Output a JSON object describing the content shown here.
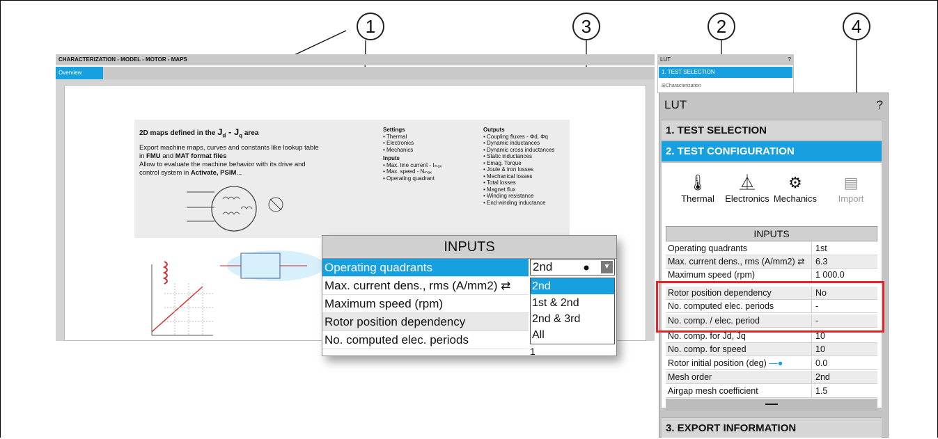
{
  "callouts": [
    "1",
    "3",
    "2",
    "4"
  ],
  "back_window": {
    "title": "CHARACTERIZATION - MODEL - MOTOR - MAPS",
    "tab": "Overview",
    "heading": "2D maps defined in the",
    "heading_math": "J",
    "heading_sub_d": "d",
    "heading_dash": " - ",
    "heading_sub_q": "q",
    "heading_tail": " area",
    "desc_1": "Export machine maps, curves and constants like lookup table",
    "desc_2_pre": "in ",
    "desc_2_b1": "FMU",
    "desc_2_mid": " and ",
    "desc_2_b2": "MAT format files",
    "desc_3": "Allow to evaluate the machine behavior with its drive and",
    "desc_4_pre": "control system in ",
    "desc_4_b": "Activate, PSIM",
    "desc_4_post": "...",
    "settings_head": "Settings",
    "settings": [
      "Thermal",
      "Electronics",
      "Mechanics"
    ],
    "inputs_head": "Inputs",
    "inputs": [
      "Max. line current - Iₘₐₓ",
      "Max. speed - Nₘₐₓ",
      "Operating quadrant"
    ],
    "outputs_head": "Outputs",
    "outputs": [
      "Coupling fluxes - Φd, Φq",
      "Dynamic inductances",
      "Dynamic cross inductances",
      "Static inductances",
      "Emag. Torque",
      "Joule & iron losses",
      "Mechanical losses",
      "Total losses",
      "Magnet flux",
      "Winding resistance",
      "End winding inductance"
    ]
  },
  "lut_back": {
    "title": "LUT",
    "help": "?",
    "selected": "1. TEST SELECTION",
    "item": "⊞Characterization"
  },
  "popup": {
    "title": "INPUTS",
    "rows": [
      "Operating quadrants",
      "Max. current dens., rms (A/mm2)",
      "Maximum speed (rpm)",
      "Rotor position dependency",
      "No. computed elec. periods"
    ],
    "dropdown_value": "2nd",
    "options": [
      "2nd",
      "1st & 2nd",
      "2nd & 3rd",
      "All"
    ],
    "last_value": "1"
  },
  "lut": {
    "title": "LUT",
    "help": "?",
    "sections": [
      "1. TEST SELECTION",
      "2. TEST CONFIGURATION",
      "3. EXPORT INFORMATION"
    ],
    "tools": [
      {
        "label": "Thermal",
        "icon": "thermometer-icon"
      },
      {
        "label": "Electronics",
        "icon": "diode-icon"
      },
      {
        "label": "Mechanics",
        "icon": "gears-icon"
      },
      {
        "label": "Import",
        "icon": "import-icon"
      }
    ],
    "inputs_title": "INPUTS",
    "rows": [
      {
        "k": "Operating quadrants",
        "v": "1st"
      },
      {
        "k": "Max. current dens., rms (A/mm2)",
        "v": "6.3"
      },
      {
        "k": "Maximum speed (rpm)",
        "v": "1 000.0"
      },
      {
        "k": "Rotor position dependency",
        "v": "No"
      },
      {
        "k": "No. computed elec. periods",
        "v": "-"
      },
      {
        "k": "No. comp. / elec. period",
        "v": "-"
      },
      {
        "k": "No. comp. for Jd, Jq",
        "v": "10"
      },
      {
        "k": "No. comp. for speed",
        "v": "10"
      },
      {
        "k": "Rotor initial position (deg)",
        "v": "0.0"
      },
      {
        "k": "Mesh order",
        "v": "2nd"
      },
      {
        "k": "Airgap mesh coefficient",
        "v": "1.5"
      }
    ],
    "collapse": "—"
  },
  "colors": {
    "accent": "#16a0e0",
    "highlight": "#e0252b"
  }
}
